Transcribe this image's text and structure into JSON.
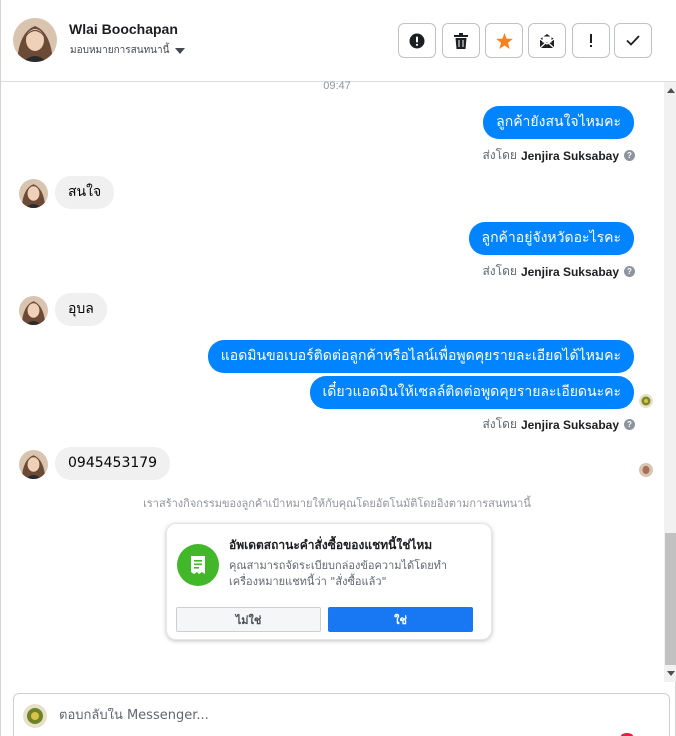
{
  "header": {
    "contact_name": "Wlai Boochapan",
    "assign_label": "มอบหมายการสนทนานี้",
    "tools": [
      {
        "name": "mark-spam",
        "icon": "alert-circle-icon"
      },
      {
        "name": "delete",
        "icon": "trash-icon"
      },
      {
        "name": "star",
        "icon": "star-icon",
        "color": "#f5821f"
      },
      {
        "name": "mark-unread",
        "icon": "envelope-icon"
      },
      {
        "name": "follow-up",
        "icon": "exclamation-icon"
      },
      {
        "name": "done",
        "icon": "checkmark-icon"
      }
    ]
  },
  "conversation": {
    "time": "09:47",
    "sent_by_prefix": "ส่งโดย",
    "sender": "Jenjira Suksabay",
    "messages": [
      {
        "dir": "out",
        "text": "ลูกค้ายังสนใจไหมคะ"
      },
      {
        "dir": "in",
        "text": "สนใจ"
      },
      {
        "dir": "out",
        "text": "ลูกค้าอยู่จังหวัดอะไรคะ"
      },
      {
        "dir": "in",
        "text": "อุบล"
      },
      {
        "dir": "out",
        "text": "แอดมินขอเบอร์ติดต่อลูกค้าหรือไลน์เพื่อพูดคุยรายละเอียดได้ไหมคะ"
      },
      {
        "dir": "out",
        "text": "เดี๋ยวแอดมินให้เซลล์ติดต่อพูดคุยรายละเอียดนะคะ"
      },
      {
        "dir": "in",
        "text": "0945453179"
      }
    ],
    "notice": "เราสร้างกิจกรรมของลูกค้าเป้าหมายให้กับคุณโดยอัตโนมัติโดยอิงตามการสนทนานี้"
  },
  "order_card": {
    "title": "อัพเดตสถานะคำสั่งซื้อของแชทนี้ใช่ไหม",
    "body": "คุณสามารถจัดระเบียบกล่องข้อความได้โดยทำเครื่องหมายแชทนี้ว่า \"สั่งซื้อแล้ว\"",
    "no_label": "ไม่ใช่",
    "yes_label": "ใช่",
    "icon": "receipt-icon",
    "icon_color": "#42b72a"
  },
  "composer": {
    "placeholder": "ตอบกลับใน Messenger..."
  },
  "colors": {
    "outgoing_bubble": "#0084ff",
    "incoming_bubble": "#f0f0f0",
    "primary_button": "#1877f2"
  }
}
